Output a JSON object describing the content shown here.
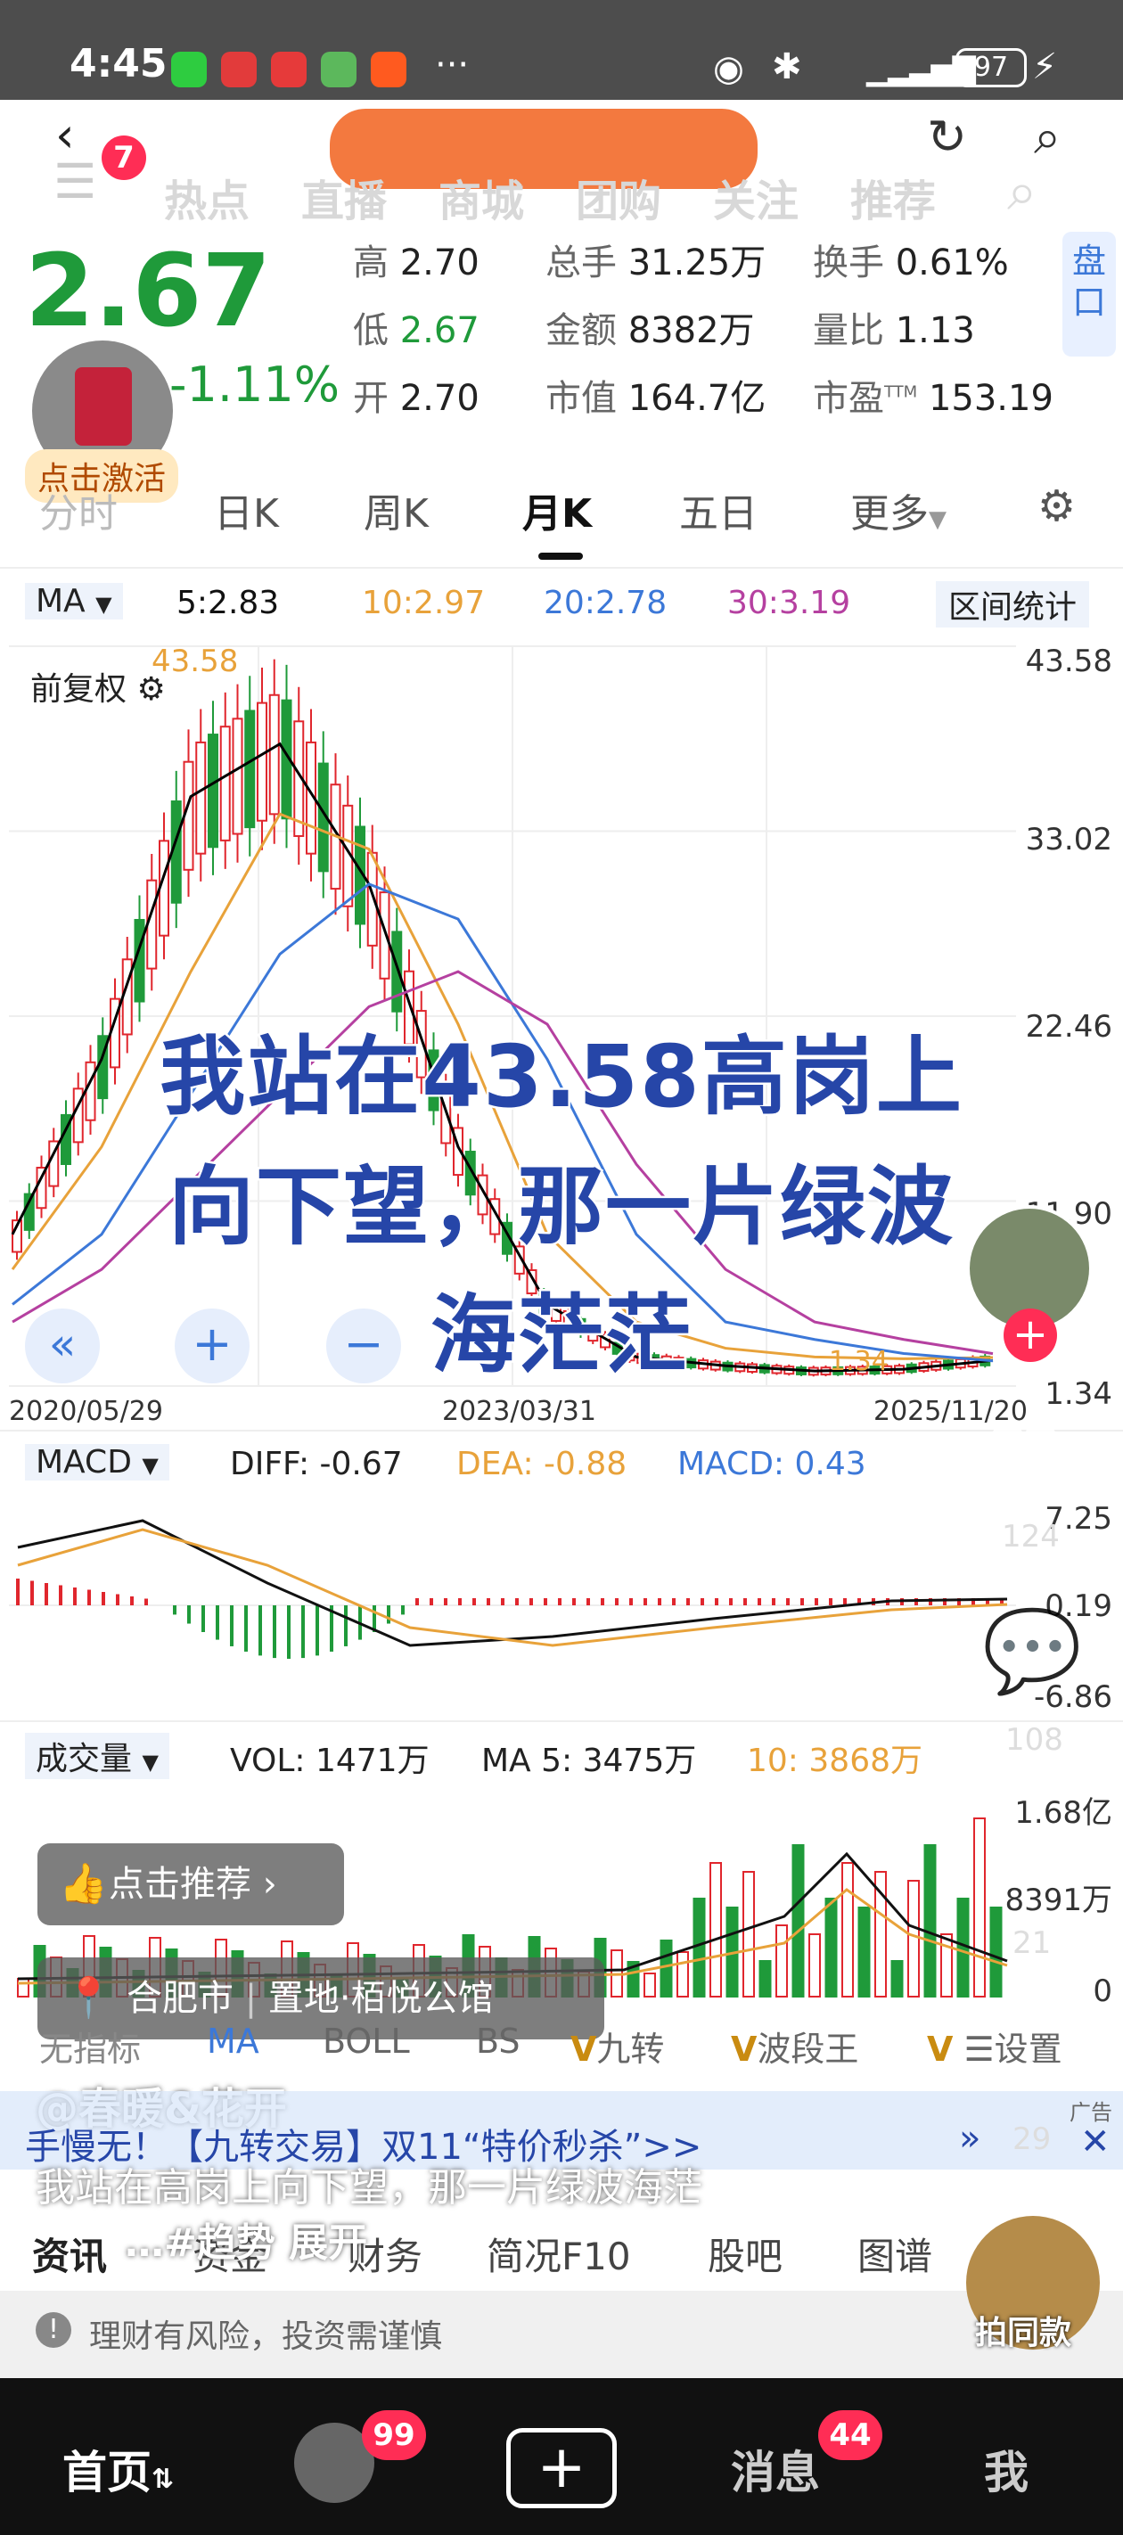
{
  "status": {
    "time": "4:45",
    "battery": "97"
  },
  "nav": {
    "back_badge": "7",
    "tabs": [
      "热点",
      "直播",
      "商城",
      "团购",
      "关注",
      "推荐"
    ]
  },
  "quote": {
    "price": "2.67",
    "change": "-1.11%",
    "high_label": "高",
    "high": "2.70",
    "low_label": "低",
    "low": "2.67",
    "open_label": "开",
    "open": "2.70",
    "vol_label": "总手",
    "vol": "31.25万",
    "amt_label": "金额",
    "amt": "8382万",
    "cap_label": "市值",
    "cap": "164.7亿",
    "turn_label": "换手",
    "turn": "0.61%",
    "ratio_label": "量比",
    "ratio": "1.13",
    "pe_label": "市盈",
    "pe_sup": "TTM",
    "pe": "153.19",
    "side_label": "盘口",
    "activate": "点击激活"
  },
  "ktabs": [
    "分时",
    "日K",
    "周K",
    "月K",
    "五日",
    "更多"
  ],
  "ma": {
    "select": "MA",
    "ma5": "5:2.83",
    "ma10": "10:2.97",
    "ma20": "20:2.78",
    "ma30": "30:3.19",
    "stat": "区间统计",
    "fq": "前复权"
  },
  "yaxis": {
    "v1": "43.58",
    "v2": "33.02",
    "v3": "22.46",
    "v4": "11.90",
    "v5": "1.34"
  },
  "xaxis": {
    "d1": "2020/05/29",
    "d2": "2023/03/31",
    "d3": "2025/11/20"
  },
  "peak_label": "43.58",
  "low_label": "1.34",
  "overlay": {
    "line1": "我站在43.58高岗上",
    "line2": "向下望，那一片绿波",
    "line3": "海茫茫"
  },
  "macd": {
    "select": "MACD",
    "diff": "DIFF: -0.67",
    "dea": "DEA: -0.88",
    "macd": "MACD: 0.43",
    "y1": "7.25",
    "y2": "0.19",
    "y3": "-6.86"
  },
  "vol": {
    "select": "成交量",
    "vol": "VOL: 1471万",
    "ma5": "MA 5: 3475万",
    "ma10": "10: 3868万",
    "y1": "1.68亿",
    "y2": "8391万",
    "y3": "0"
  },
  "side": {
    "likes": "124",
    "comments": "108",
    "stars": "21",
    "shares": "29"
  },
  "recommend": "点击推荐",
  "location": {
    "city": "合肥市",
    "place": "置地·栢悦公馆"
  },
  "indicators": [
    "无指标",
    "MA",
    "BOLL",
    "BS",
    "九转",
    "波段王",
    "设置"
  ],
  "author": "@春暖&花开",
  "ad": {
    "text": "手慢无！【九转交易】双11“特价秒杀”>>",
    "tag": "广告"
  },
  "caption": "我站在高岗上向下望，那一片绿波海茫",
  "hashtags": "…#趋势 展开",
  "btabs": [
    "资讯",
    "资金",
    "财务",
    "简况F10",
    "股吧",
    "图谱"
  ],
  "risk": "理财有风险，投资需谨慎",
  "same": "拍同款",
  "bottom": {
    "home": "首页",
    "msgs": "消息",
    "me": "我",
    "avatar_badge": "99",
    "msg_badge": "44"
  },
  "colors": {
    "up": "#e0262d",
    "down": "#1f9a3a",
    "ma5": "#000000",
    "ma10": "#e8a23a",
    "ma20": "#3c78d8",
    "ma30": "#b540a0",
    "overlay": "#2646a8"
  },
  "chart_data": {
    "type": "candlestick",
    "title": "月K",
    "x": [
      "2020/05/29",
      "2023/03/31",
      "2025/11/20"
    ],
    "ylim": [
      1.34,
      43.58
    ],
    "series": [
      {
        "name": "MA5",
        "values": [
          10,
          20,
          35,
          38,
          30,
          15,
          6,
          3,
          2.5,
          2.2,
          2.3,
          2.8
        ]
      },
      {
        "name": "MA10",
        "values": [
          8,
          15,
          25,
          34,
          32,
          22,
          10,
          5,
          3.5,
          3,
          2.9,
          2.97
        ]
      },
      {
        "name": "MA20",
        "values": [
          6,
          10,
          18,
          26,
          30,
          28,
          20,
          10,
          5,
          4,
          3.2,
          2.78
        ]
      },
      {
        "name": "MA30",
        "values": [
          5,
          8,
          13,
          18,
          23,
          25,
          22,
          14,
          8,
          5,
          4,
          3.19
        ]
      }
    ]
  }
}
